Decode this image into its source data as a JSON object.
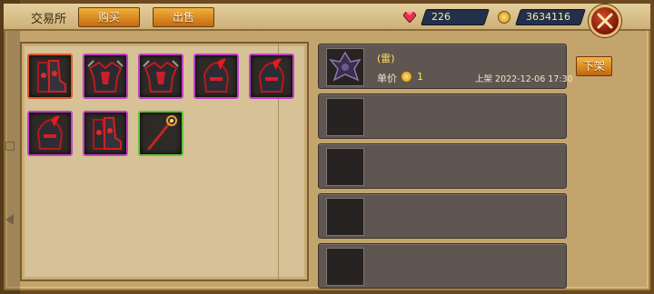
{
  "header": {
    "title": "交易所",
    "tab_buy": "购买",
    "tab_sell": "出售",
    "gems": "226",
    "gold": "3634116"
  },
  "inventory": {
    "slots": [
      {
        "icon": "boots-icon",
        "quality": "orange"
      },
      {
        "icon": "chest-armor-icon",
        "quality": "purple"
      },
      {
        "icon": "chest-armor-icon",
        "quality": "purple"
      },
      {
        "icon": "helmet-icon",
        "quality": "purple"
      },
      {
        "icon": "helmet-icon",
        "quality": "purple"
      },
      {
        "icon": "helmet-icon",
        "quality": "purple"
      },
      {
        "icon": "boots-icon",
        "quality": "purple"
      },
      {
        "icon": "staff-icon",
        "quality": "green"
      }
    ]
  },
  "listing": {
    "item_name": "",
    "item_suffix": "(雷)",
    "price_label": "单价",
    "price": "1",
    "listed_label": "上架",
    "listed_time": "2022-12-06 17:30",
    "delist_label": "下架"
  },
  "colors": {
    "purple_quality": "#c23fc7",
    "orange_quality": "#e0582a",
    "green_quality": "#5ec43a",
    "button_orange": "#e08a22",
    "name_red": "#ff3a2c"
  }
}
